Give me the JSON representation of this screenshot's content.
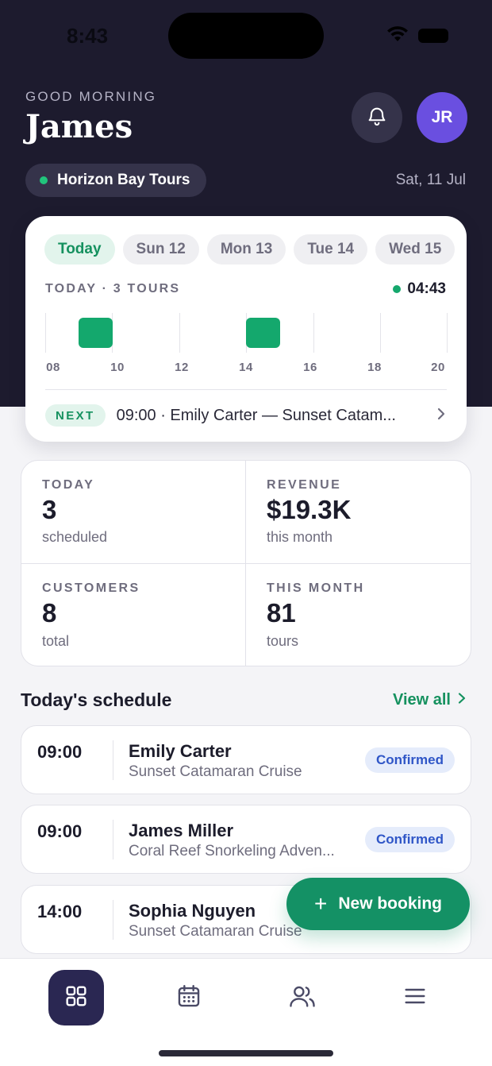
{
  "status_bar": {
    "time": "8:43"
  },
  "header": {
    "greeting": "GOOD MORNING",
    "name": "James",
    "avatar_initials": "JR",
    "org_name": "Horizon Bay Tours",
    "date": "Sat, 11 Jul"
  },
  "week": {
    "days": [
      "Today",
      "Sun 12",
      "Mon 13",
      "Tue 14",
      "Wed 15"
    ],
    "selected": "Today",
    "summary": "TODAY · 3 TOURS",
    "clock": "04:43",
    "timeline_hours": [
      "08",
      "10",
      "12",
      "14",
      "16",
      "18",
      "20"
    ],
    "next_label": "NEXT",
    "next_text": "09:00 · Emily Carter — Sunset Catam..."
  },
  "stats": [
    {
      "label": "TODAY",
      "value": "3",
      "sub": "scheduled"
    },
    {
      "label": "REVENUE",
      "value": "$19.3K",
      "sub": "this month"
    },
    {
      "label": "CUSTOMERS",
      "value": "8",
      "sub": "total"
    },
    {
      "label": "THIS MONTH",
      "value": "81",
      "sub": "tours"
    }
  ],
  "schedule": {
    "title": "Today's schedule",
    "view_all": "View all",
    "items": [
      {
        "time": "09:00",
        "name": "Emily Carter",
        "tour": "Sunset Catamaran Cruise",
        "status": "Confirmed"
      },
      {
        "time": "09:00",
        "name": "James Miller",
        "tour": "Coral Reef Snorkeling Adven...",
        "status": "Confirmed"
      },
      {
        "time": "14:00",
        "name": "Sophia Nguyen",
        "tour": "Sunset Catamaran Cruise",
        "status": ""
      }
    ]
  },
  "fab": {
    "icon": "plus-icon",
    "label": "New booking"
  },
  "tabbar": {
    "items": [
      {
        "icon": "dashboard-grid-icon",
        "active": true
      },
      {
        "icon": "calendar-icon",
        "active": false
      },
      {
        "icon": "users-icon",
        "active": false
      },
      {
        "icon": "menu-icon",
        "active": false
      }
    ]
  },
  "colors": {
    "hero_bg": "#1d1b2e",
    "accent_green": "#15915f",
    "avatar_purple": "#6a4fe0",
    "badge_blue": "#2f56c7"
  }
}
